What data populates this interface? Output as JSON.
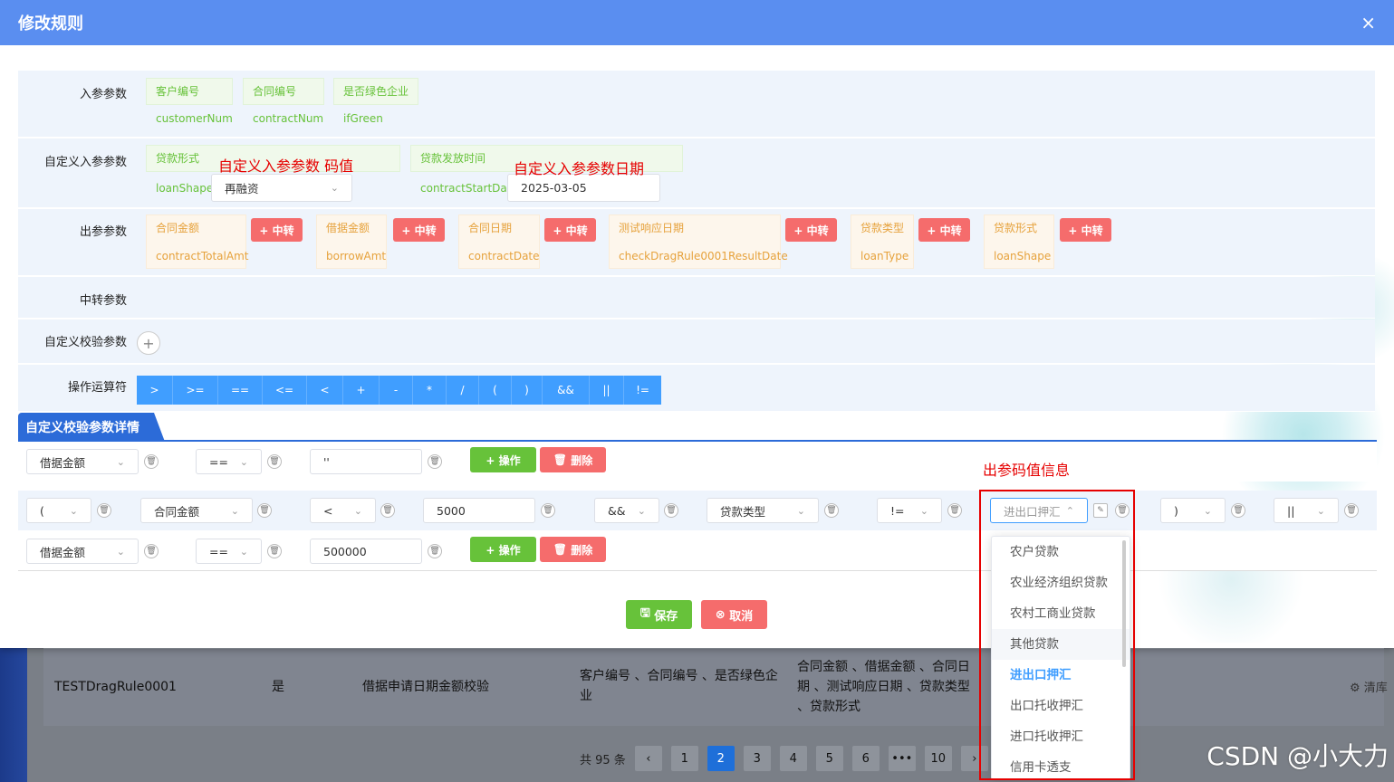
{
  "dialog": {
    "title": "修改规则",
    "close_label": "×"
  },
  "rows": {
    "input_params": {
      "label": "入参参数",
      "tags": [
        {
          "name": "客户编号",
          "code": "customerNum"
        },
        {
          "name": "合同编号",
          "code": "contractNum"
        },
        {
          "name": "是否绿色企业",
          "code": "ifGreen"
        }
      ]
    },
    "custom_input_params": {
      "label": "自定义入参参数",
      "tags": [
        {
          "name": "贷款形式",
          "code": "loanShape",
          "value": "再融资"
        },
        {
          "name": "贷款发放时间",
          "code": "contractStartDate",
          "value": "2025-03-05"
        }
      ]
    },
    "output_params": {
      "label": "出参参数",
      "transfer_label": "+ 中转",
      "tags": [
        {
          "name": "合同金额",
          "code": "contractTotalAmt"
        },
        {
          "name": "借据金额",
          "code": "borrowAmt"
        },
        {
          "name": "合同日期",
          "code": "contractDate"
        },
        {
          "name": "测试响应日期",
          "code": "checkDragRule0001ResultDate"
        },
        {
          "name": "贷款类型",
          "code": "loanType"
        },
        {
          "name": "贷款形式",
          "code": "loanShape"
        }
      ]
    },
    "transfer_params": {
      "label": "中转参数"
    },
    "custom_check_params": {
      "label": "自定义校验参数",
      "add_icon": "+"
    },
    "operators": {
      "label": "操作运算符",
      "items": [
        ">",
        ">=",
        "==",
        "<=",
        "<",
        "+",
        "-",
        "*",
        "/",
        "(",
        ")",
        "&&",
        "||",
        "!="
      ]
    }
  },
  "annotations": {
    "code_value": "自定义入参参数 码值",
    "date": "自定义入参参数日期",
    "output_code_info": "出参码值信息"
  },
  "section": {
    "title": "自定义校验参数详情"
  },
  "rule_rows": [
    {
      "field": "借据金额",
      "op": "==",
      "value": "''",
      "add": "+ 操作",
      "del": "删除"
    },
    {
      "items": [
        "(",
        "合同金额",
        "<",
        "5000",
        "&&",
        "贷款类型",
        "!=",
        "进出口押汇",
        ")",
        "||"
      ]
    },
    {
      "field": "借据金额",
      "op": "==",
      "value": "500000",
      "add": "+ 操作",
      "del": "删除"
    }
  ],
  "dropdown": {
    "options": [
      "农户贷款",
      "农业经济组织贷款",
      "农村工商业贷款",
      "其他贷款",
      "进出口押汇",
      "出口托收押汇",
      "进口托收押汇",
      "信用卡透支"
    ],
    "selected": "进出口押汇",
    "hovered": "其他贷款"
  },
  "footer": {
    "save": "保存",
    "cancel": "取消"
  },
  "background_table": {
    "cells": [
      "TESTDragRule0001",
      "是",
      "借据申请日期金额校验",
      "客户编号 、合同编号 、是否绿色企业",
      "合同金额 、借据金额 、合同日期 、测试响应日期 、贷款类型 、贷款形式"
    ],
    "side": "清库",
    "pager_total": "共 95 条",
    "pages": [
      "‹",
      "1",
      "2",
      "3",
      "4",
      "5",
      "6",
      "•••",
      "10",
      "›"
    ],
    "current_page": "2"
  },
  "watermark": "CSDN @小大力",
  "colors": {
    "header": "#5a8ef0",
    "accent": "#409eff",
    "green": "#67c23a",
    "red": "#f56c6c",
    "orange": "#e6a23c",
    "annotation": "#e60000"
  }
}
